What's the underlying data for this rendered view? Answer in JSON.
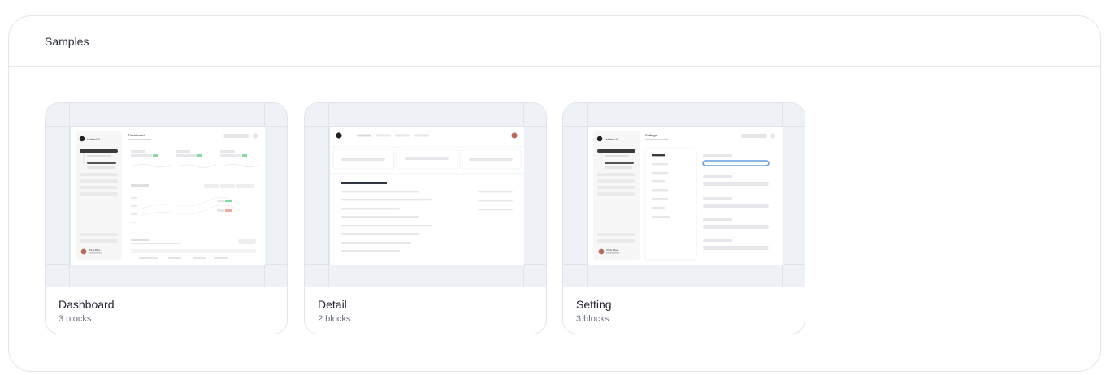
{
  "panel": {
    "title": "Samples"
  },
  "samples": [
    {
      "title": "Dashboard",
      "subtitle": "3 blocks",
      "thumb_brand": "Untitled UI",
      "thumb_heading": "Dashboard",
      "thumb_user": "Olivia Rhye"
    },
    {
      "title": "Detail",
      "subtitle": "2 blocks"
    },
    {
      "title": "Setting",
      "subtitle": "3 blocks",
      "thumb_brand": "Untitled UI",
      "thumb_heading": "Settings",
      "thumb_user": "Olivia Rhye"
    }
  ],
  "colors": {
    "accent": "#6b9bde",
    "success": "#86dca0",
    "danger": "#f2a89c"
  }
}
